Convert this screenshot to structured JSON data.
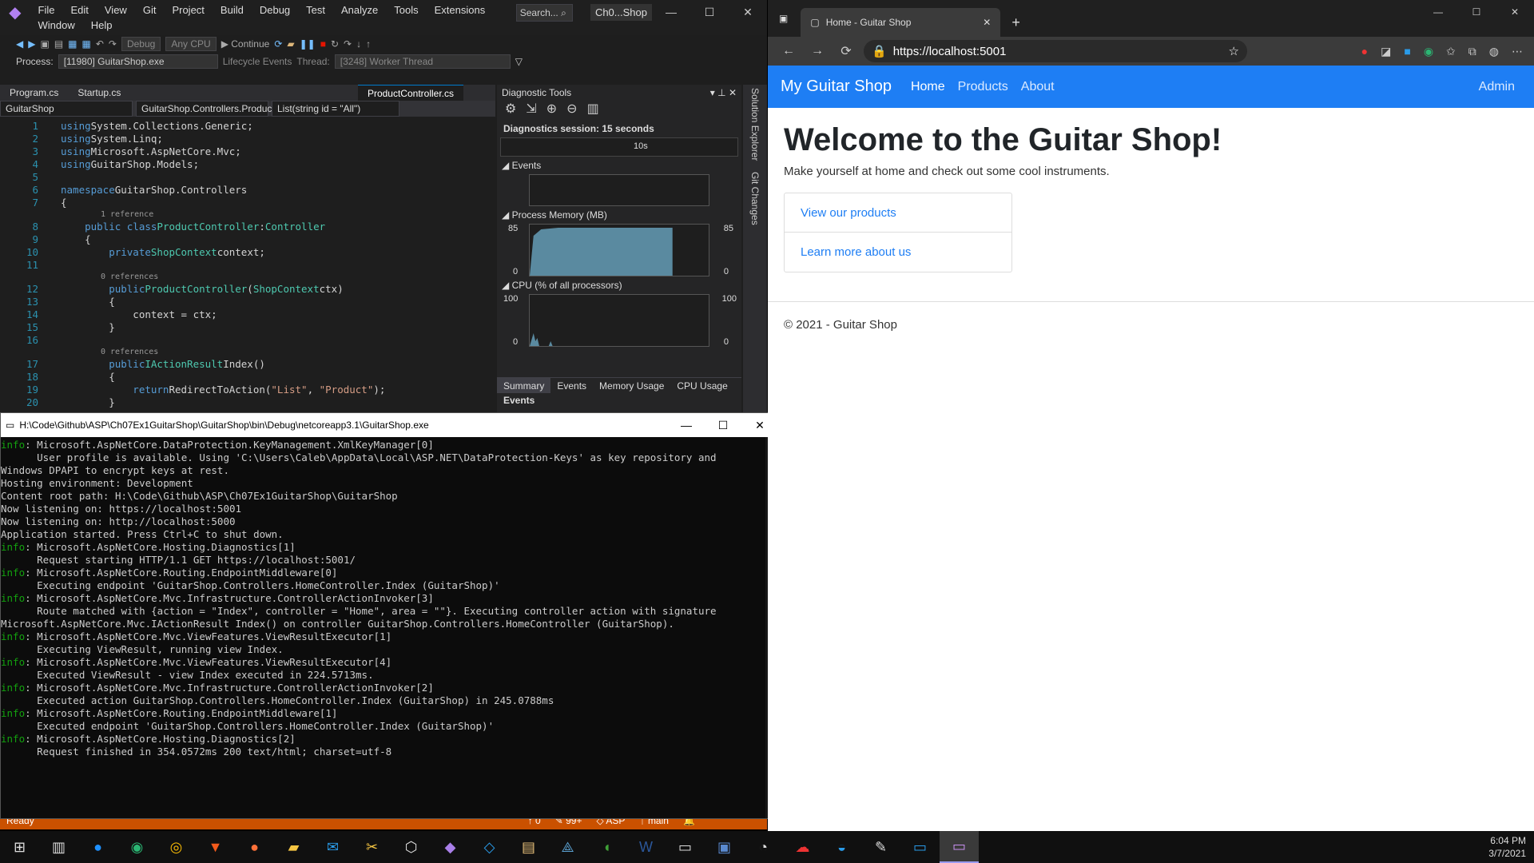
{
  "vs": {
    "menu": [
      "File",
      "Edit",
      "View",
      "Git",
      "Project",
      "Build",
      "Debug",
      "Test",
      "Analyze",
      "Tools",
      "Extensions",
      "Window",
      "Help"
    ],
    "search": "Search...",
    "solution": "Ch0...Shop",
    "toolbar": {
      "config": "Debug",
      "platform": "Any CPU",
      "continue": "Continue"
    },
    "process": {
      "label": "Process:",
      "value": "[11980] GuitarShop.exe",
      "lifecycle": "Lifecycle Events",
      "thread_label": "Thread:",
      "thread": "[3248] Worker Thread"
    },
    "tabs": [
      "Program.cs",
      "Startup.cs",
      "ProductController.cs"
    ],
    "nav": [
      "GuitarShop",
      "GuitarShop.Controllers.Product",
      "List(string id = \"All\")"
    ],
    "status": {
      "ready": "Ready",
      "up": "0",
      "pencil": "99+",
      "repo": "ASP",
      "branch": "main"
    }
  },
  "code": [
    {
      "n": "1",
      "parts": [
        [
          "kw",
          "using"
        ],
        [
          "",
          "System.Collections.Generic;"
        ]
      ]
    },
    {
      "n": "2",
      "parts": [
        [
          "kw",
          "using"
        ],
        [
          "",
          "System.Linq;"
        ]
      ]
    },
    {
      "n": "3",
      "parts": [
        [
          "kw",
          "using"
        ],
        [
          "",
          "Microsoft.AspNetCore.Mvc;"
        ]
      ]
    },
    {
      "n": "4",
      "parts": [
        [
          "kw",
          "using"
        ],
        [
          "",
          "GuitarShop.Models;"
        ]
      ]
    },
    {
      "n": "5",
      "parts": []
    },
    {
      "n": "6",
      "parts": [
        [
          "kw",
          "namespace"
        ],
        [
          "",
          "GuitarShop.Controllers"
        ]
      ]
    },
    {
      "n": "7",
      "parts": [
        [
          "",
          "{"
        ]
      ]
    },
    {
      "lens": "1 reference"
    },
    {
      "n": "8",
      "parts": [
        [
          "kw",
          "    public class"
        ],
        [
          "ty",
          "ProductController"
        ],
        [
          "",
          ":"
        ],
        [
          "ty",
          "Controller"
        ]
      ]
    },
    {
      "n": "9",
      "parts": [
        [
          "",
          "    {"
        ]
      ]
    },
    {
      "n": "10",
      "parts": [
        [
          "kw",
          "        private"
        ],
        [
          "ty",
          "ShopContext"
        ],
        [
          "",
          "context;"
        ]
      ]
    },
    {
      "n": "11",
      "parts": []
    },
    {
      "lens": "0 references"
    },
    {
      "n": "12",
      "parts": [
        [
          "kw",
          "        public"
        ],
        [
          "ty",
          "ProductController"
        ],
        [
          "",
          "("
        ],
        [
          "ty",
          "ShopContext"
        ],
        [
          "",
          "ctx)"
        ]
      ]
    },
    {
      "n": "13",
      "parts": [
        [
          "",
          "        {"
        ]
      ]
    },
    {
      "n": "14",
      "parts": [
        [
          "",
          "            context = ctx;"
        ]
      ]
    },
    {
      "n": "15",
      "parts": [
        [
          "",
          "        }"
        ]
      ]
    },
    {
      "n": "16",
      "parts": []
    },
    {
      "lens": "0 references"
    },
    {
      "n": "17",
      "parts": [
        [
          "kw",
          "        public"
        ],
        [
          "ty",
          "IActionResult"
        ],
        [
          "",
          "Index()"
        ]
      ]
    },
    {
      "n": "18",
      "parts": [
        [
          "",
          "        {"
        ]
      ]
    },
    {
      "n": "19",
      "parts": [
        [
          "kw",
          "            return"
        ],
        [
          "",
          "RedirectToAction("
        ],
        [
          "st",
          "\"List\""
        ],
        [
          "",
          ", "
        ],
        [
          "st",
          "\"Product\""
        ],
        [
          "",
          ");"
        ]
      ]
    },
    {
      "n": "20",
      "parts": [
        [
          "",
          "        }"
        ]
      ]
    }
  ],
  "diag": {
    "title": "Diagnostic Tools",
    "session": "Diagnostics session: 15 seconds",
    "tick": "10s",
    "events": "Events",
    "memory": "Process Memory (MB)",
    "mem_max": "85",
    "mem_min": "0",
    "cpu": "CPU (% of all processors)",
    "cpu_max": "100",
    "cpu_min": "0",
    "tabs": [
      "Summary",
      "Events",
      "Memory Usage",
      "CPU Usage"
    ],
    "events_footer": "Events"
  },
  "side": [
    "Solution Explorer",
    "Git Changes"
  ],
  "console": {
    "title": "H:\\Code\\Github\\ASP\\Ch07Ex1GuitarShop\\GuitarShop\\bin\\Debug\\netcoreapp3.1\\GuitarShop.exe",
    "lines": [
      [
        "info",
        ": Microsoft.AspNetCore.DataProtection.KeyManagement.XmlKeyManager[0]"
      ],
      [
        "",
        "      User profile is available. Using 'C:\\Users\\Caleb\\AppData\\Local\\ASP.NET\\DataProtection-Keys' as key repository and"
      ],
      [
        "",
        "Windows DPAPI to encrypt keys at rest."
      ],
      [
        "",
        "Hosting environment: Development"
      ],
      [
        "",
        "Content root path: H:\\Code\\Github\\ASP\\Ch07Ex1GuitarShop\\GuitarShop"
      ],
      [
        "",
        "Now listening on: https://localhost:5001"
      ],
      [
        "",
        "Now listening on: http://localhost:5000"
      ],
      [
        "",
        "Application started. Press Ctrl+C to shut down."
      ],
      [
        "info",
        ": Microsoft.AspNetCore.Hosting.Diagnostics[1]"
      ],
      [
        "",
        "      Request starting HTTP/1.1 GET https://localhost:5001/"
      ],
      [
        "info",
        ": Microsoft.AspNetCore.Routing.EndpointMiddleware[0]"
      ],
      [
        "",
        "      Executing endpoint 'GuitarShop.Controllers.HomeController.Index (GuitarShop)'"
      ],
      [
        "info",
        ": Microsoft.AspNetCore.Mvc.Infrastructure.ControllerActionInvoker[3]"
      ],
      [
        "",
        "      Route matched with {action = \"Index\", controller = \"Home\", area = \"\"}. Executing controller action with signature"
      ],
      [
        "",
        "Microsoft.AspNetCore.Mvc.IActionResult Index() on controller GuitarShop.Controllers.HomeController (GuitarShop)."
      ],
      [
        "info",
        ": Microsoft.AspNetCore.Mvc.ViewFeatures.ViewResultExecutor[1]"
      ],
      [
        "",
        "      Executing ViewResult, running view Index."
      ],
      [
        "info",
        ": Microsoft.AspNetCore.Mvc.ViewFeatures.ViewResultExecutor[4]"
      ],
      [
        "",
        "      Executed ViewResult - view Index executed in 224.5713ms."
      ],
      [
        "info",
        ": Microsoft.AspNetCore.Mvc.Infrastructure.ControllerActionInvoker[2]"
      ],
      [
        "",
        "      Executed action GuitarShop.Controllers.HomeController.Index (GuitarShop) in 245.0788ms"
      ],
      [
        "info",
        ": Microsoft.AspNetCore.Routing.EndpointMiddleware[1]"
      ],
      [
        "",
        "      Executed endpoint 'GuitarShop.Controllers.HomeController.Index (GuitarShop)'"
      ],
      [
        "info",
        ": Microsoft.AspNetCore.Hosting.Diagnostics[2]"
      ],
      [
        "",
        "      Request finished in 354.0572ms 200 text/html; charset=utf-8"
      ]
    ]
  },
  "edge": {
    "tab_title": "Home - Guitar Shop",
    "url": "https://localhost:5001"
  },
  "site": {
    "brand": "My Guitar Shop",
    "nav": [
      "Home",
      "Products",
      "About"
    ],
    "admin": "Admin",
    "heading": "Welcome to the Guitar Shop!",
    "lead": "Make yourself at home and check out some cool instruments.",
    "links": [
      "View our products",
      "Learn more about us"
    ],
    "footer": "© 2021 - Guitar Shop"
  },
  "taskbar": {
    "time": "6:04 PM",
    "date": "3/7/2021"
  }
}
